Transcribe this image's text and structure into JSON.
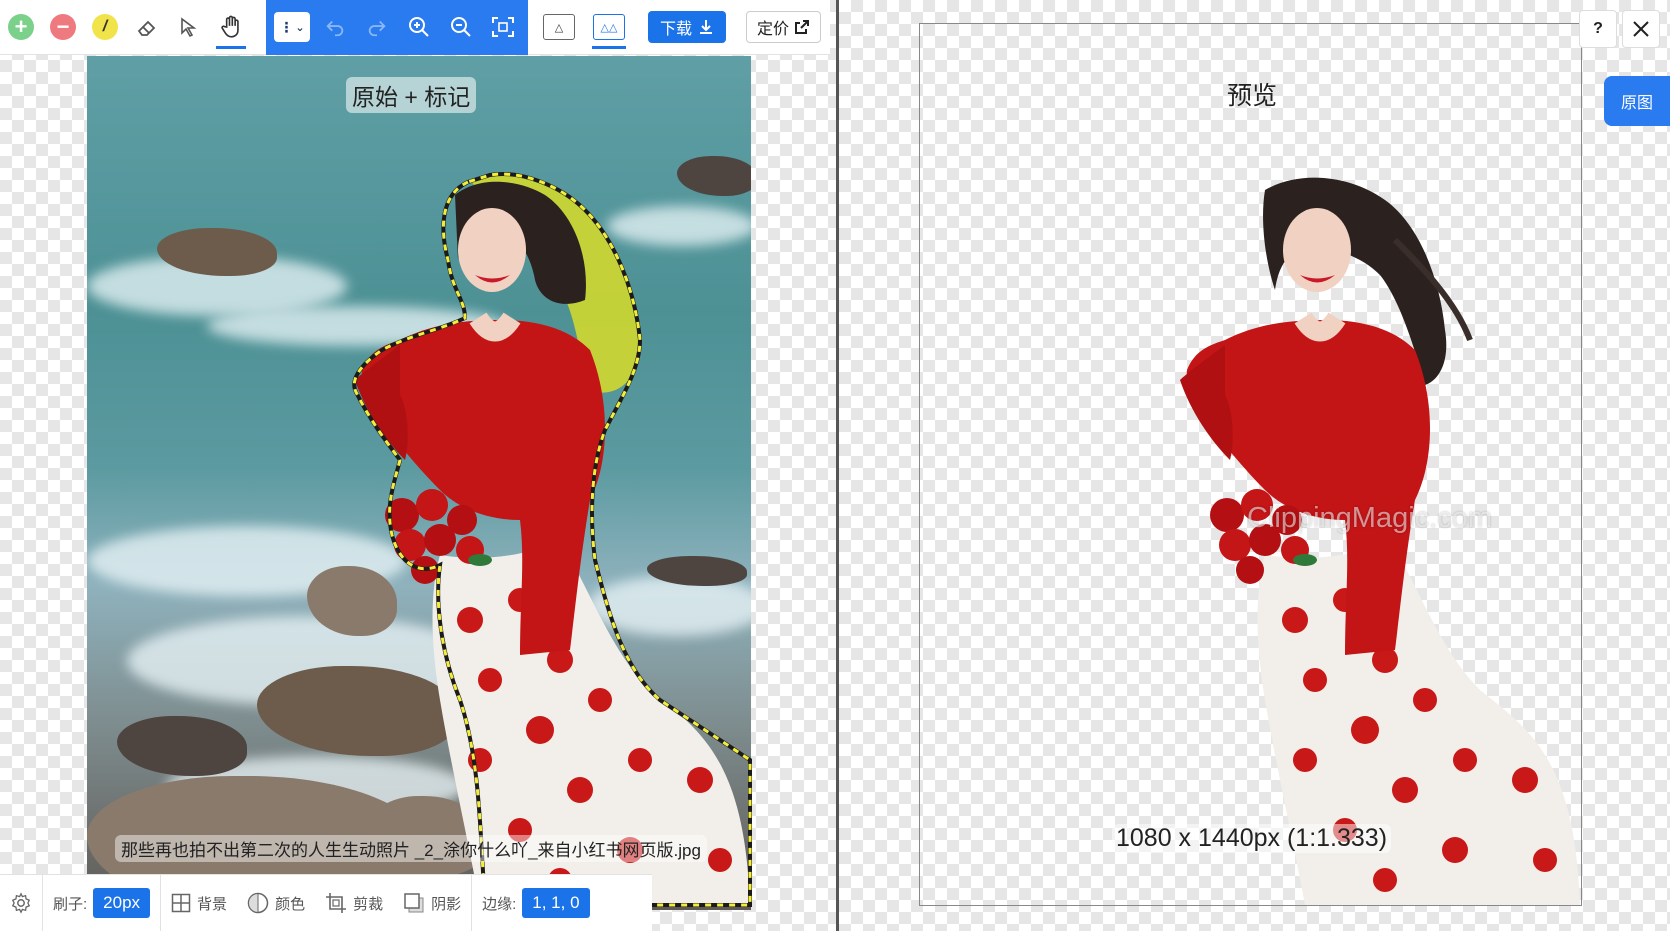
{
  "toolbar": {
    "tools": [
      {
        "name": "keep-marker",
        "icon": "plus-circle-icon"
      },
      {
        "name": "remove-marker",
        "icon": "minus-circle-icon"
      },
      {
        "name": "hair-marker",
        "icon": "pen-icon"
      },
      {
        "name": "eraser",
        "icon": "eraser-icon"
      },
      {
        "name": "scalpel",
        "icon": "cursor-icon"
      },
      {
        "name": "pan",
        "icon": "hand-icon",
        "active": true
      }
    ],
    "dropdown_label": "⋮",
    "download_label": "下载",
    "price_label": "定价"
  },
  "left": {
    "title": "原始 + 标记",
    "file_name": "那些再也拍不出第二次的人生生动照片 _2_涂你什么吖_来自小红书网页版.jpg"
  },
  "bottombar": {
    "brush_label": "刷子:",
    "brush_value": "20px",
    "background_label": "背景",
    "color_label": "颜色",
    "crop_label": "剪裁",
    "shadow_label": "阴影",
    "edge_label": "边缘:",
    "edge_value": "1, 1, 0"
  },
  "right": {
    "title": "预览",
    "size_text": "1080 x 1440px (1:1.333)",
    "watermark": "ClippingMagic.com",
    "help_label": "?",
    "original_tab_label": "原图"
  },
  "colors": {
    "accent": "#1a73e8",
    "toolbar_blue": "#2a7bef",
    "keep_green": "#7bd08a",
    "remove_red": "#ee7a80",
    "hair_yellow": "#f1e34a"
  }
}
